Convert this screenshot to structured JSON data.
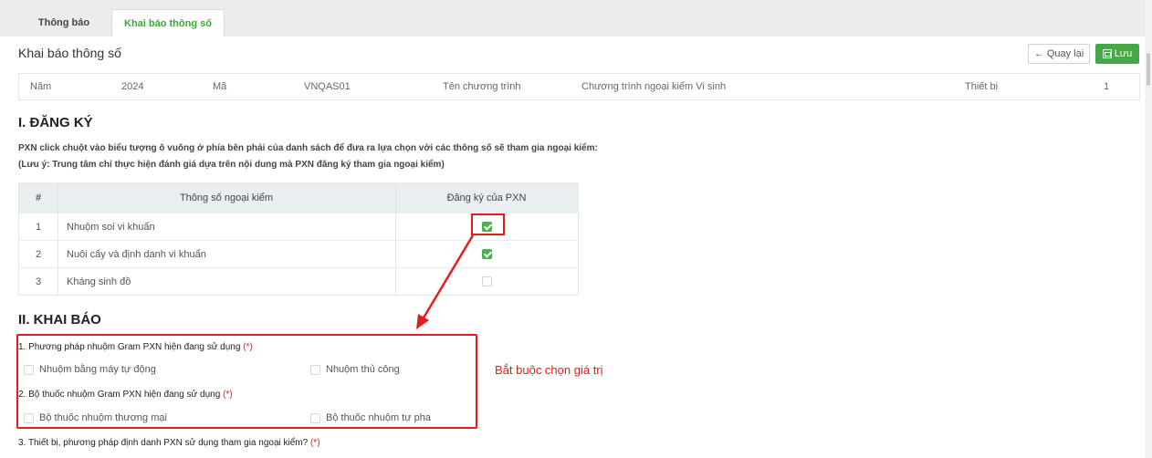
{
  "tabs": [
    {
      "label": "Thông báo"
    },
    {
      "label": "Khai báo thông số"
    }
  ],
  "header": {
    "title": "Khai báo thông số",
    "back_label": "Quay lại",
    "save_label": "Lưu"
  },
  "info": {
    "year_label": "Năm",
    "year_value": "2024",
    "code_label": "Mã",
    "code_value": "VNQAS01",
    "program_label": "Tên chương trình",
    "program_value": "Chương trình ngoại kiểm Vi sinh",
    "device_label": "Thiết bị",
    "device_value": "1"
  },
  "section1": {
    "title": "I. ĐĂNG KÝ",
    "note1": "PXN click chuột vào biểu tượng ô vuông ở phía bên phải của danh sách để đưa ra lựa chọn với các thông số sẽ tham gia ngoại kiểm:",
    "note2": "(Lưu ý: Trung tâm chỉ thực hiện đánh giá dựa trên nội dung mà PXN đăng ký tham gia ngoại kiểm)",
    "col_index": "#",
    "col_param": "Thông số ngoại kiểm",
    "col_reg": "Đăng ký của PXN",
    "rows": [
      {
        "index": "1",
        "name": "Nhuộm soi vi khuẩn",
        "checked": true
      },
      {
        "index": "2",
        "name": "Nuôi cấy và định danh vi khuẩn",
        "checked": true
      },
      {
        "index": "3",
        "name": "Kháng sinh đồ",
        "checked": false
      }
    ]
  },
  "section2": {
    "title": "II. KHAI BÁO",
    "q1": "1. Phương pháp nhuộm Gram PXN hiện đang sử dụng",
    "q1_opts": [
      "Nhuộm bằng máy tự động",
      "Nhuộm thủ công"
    ],
    "q2": "2. Bộ thuốc nhuộm Gram PXN hiện đang sử dụng",
    "q2_opts": [
      "Bộ thuốc nhuộm thương mại",
      "Bộ thuốc nhuộm tự pha"
    ],
    "q3": "3. Thiết bị, phương pháp định danh PXN sử dụng tham gia ngoại kiểm?",
    "required_mark": "(*)"
  },
  "annotation": {
    "callout": "Bắt buộc chọn giá trị",
    "color": "#e21d1d"
  },
  "colors": {
    "accent_green": "#48a847",
    "checkbox_green": "#4caf50",
    "table_header_bg": "#e9eef0"
  }
}
